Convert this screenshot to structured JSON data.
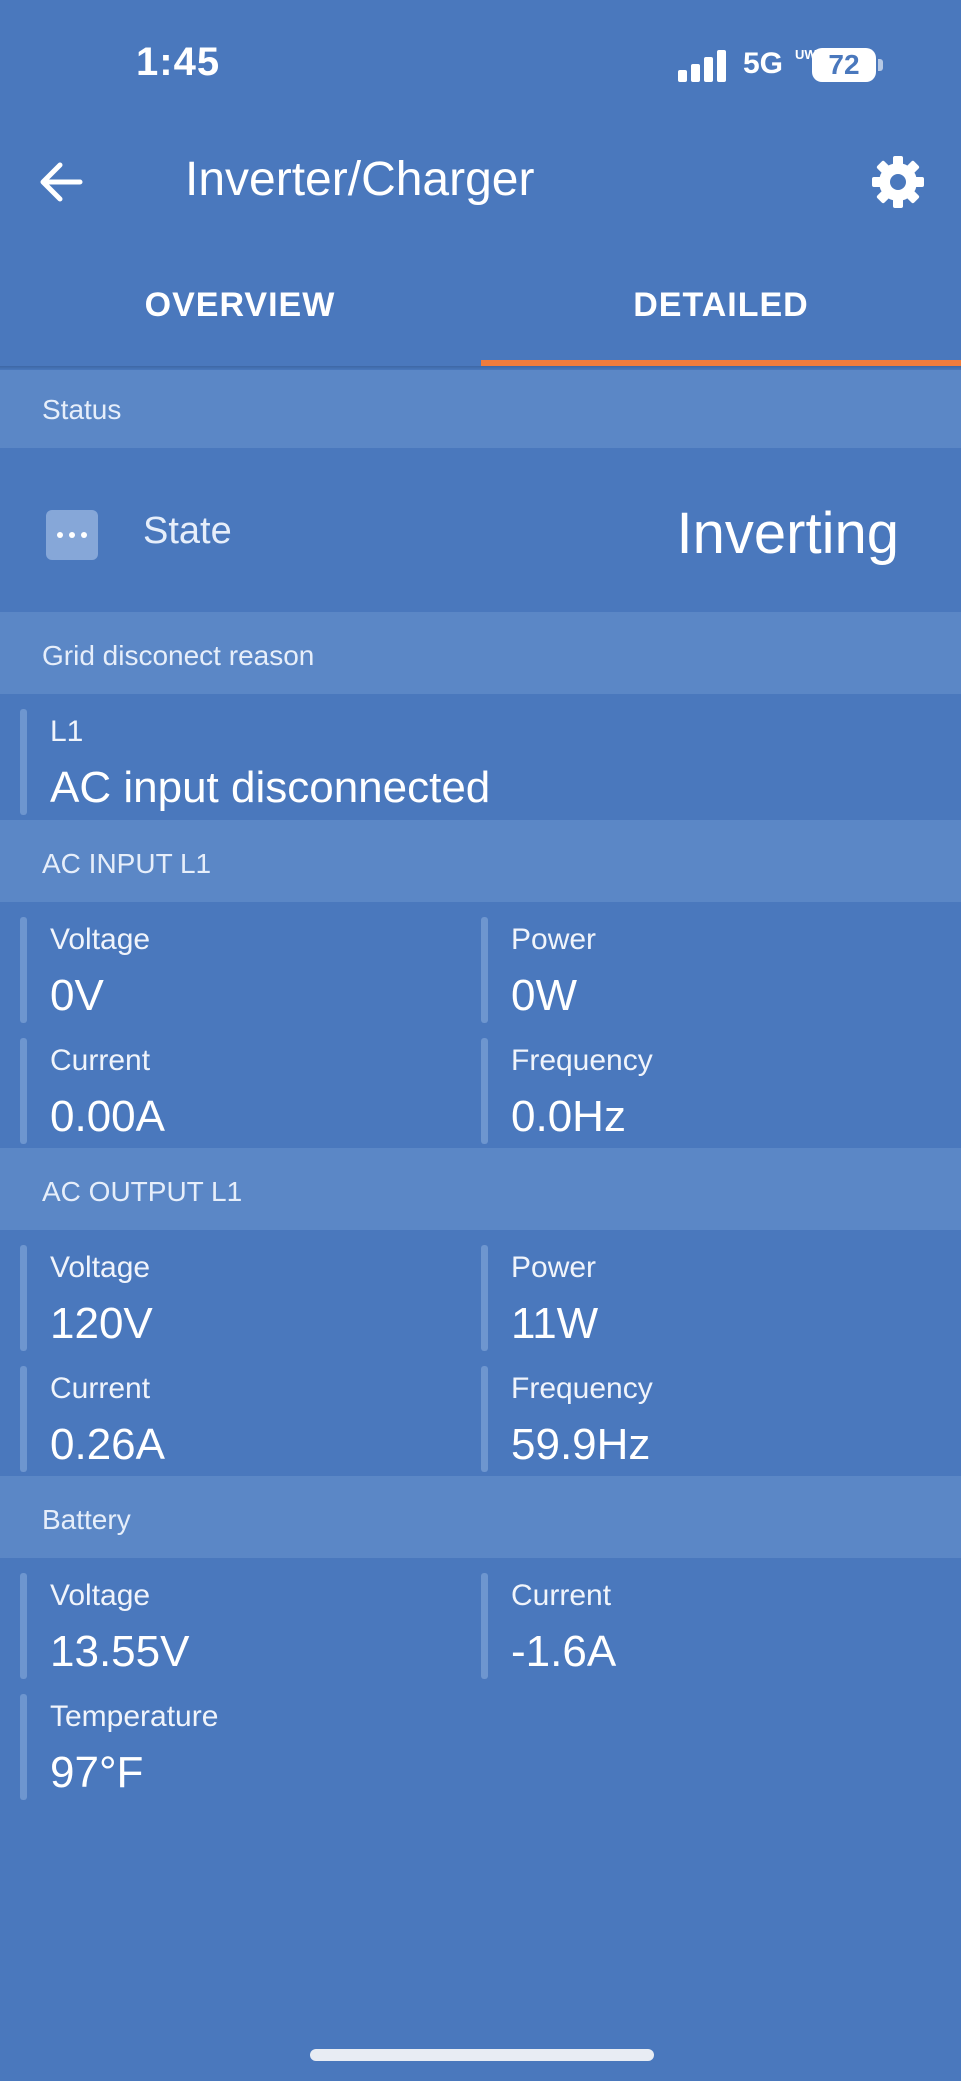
{
  "status_bar": {
    "time": "1:45",
    "network": "5G",
    "network_superscript": "UW",
    "battery": "72"
  },
  "header": {
    "title": "Inverter/Charger",
    "back_icon": "arrow-left-icon",
    "settings_icon": "gear-icon"
  },
  "tabs": {
    "overview": "OVERVIEW",
    "detailed": "DETAILED",
    "active": "DETAILED",
    "indicator_color": "#f07c3d"
  },
  "status": {
    "header": "Status",
    "state_label": "State",
    "state_value": "Inverting",
    "state_icon": "more-dots-icon"
  },
  "grid": {
    "header": "Grid disconect reason",
    "l1_label": "L1",
    "l1_value": "AC input disconnected"
  },
  "ac_input": {
    "header": "AC INPUT L1",
    "voltage_label": "Voltage",
    "voltage_value": "0V",
    "power_label": "Power",
    "power_value": "0W",
    "current_label": "Current",
    "current_value": "0.00A",
    "frequency_label": "Frequency",
    "frequency_value": "0.0Hz"
  },
  "ac_output": {
    "header": "AC OUTPUT L1",
    "voltage_label": "Voltage",
    "voltage_value": "120V",
    "power_label": "Power",
    "power_value": "11W",
    "current_label": "Current",
    "current_value": "0.26A",
    "frequency_label": "Frequency",
    "frequency_value": "59.9Hz"
  },
  "battery": {
    "header": "Battery",
    "voltage_label": "Voltage",
    "voltage_value": "13.55V",
    "current_label": "Current",
    "current_value": "-1.6A",
    "temperature_label": "Temperature",
    "temperature_value": "97°F"
  },
  "colors": {
    "background": "#4a78bd",
    "section_header": "#5b87c6",
    "accent": "#f07c3d"
  }
}
